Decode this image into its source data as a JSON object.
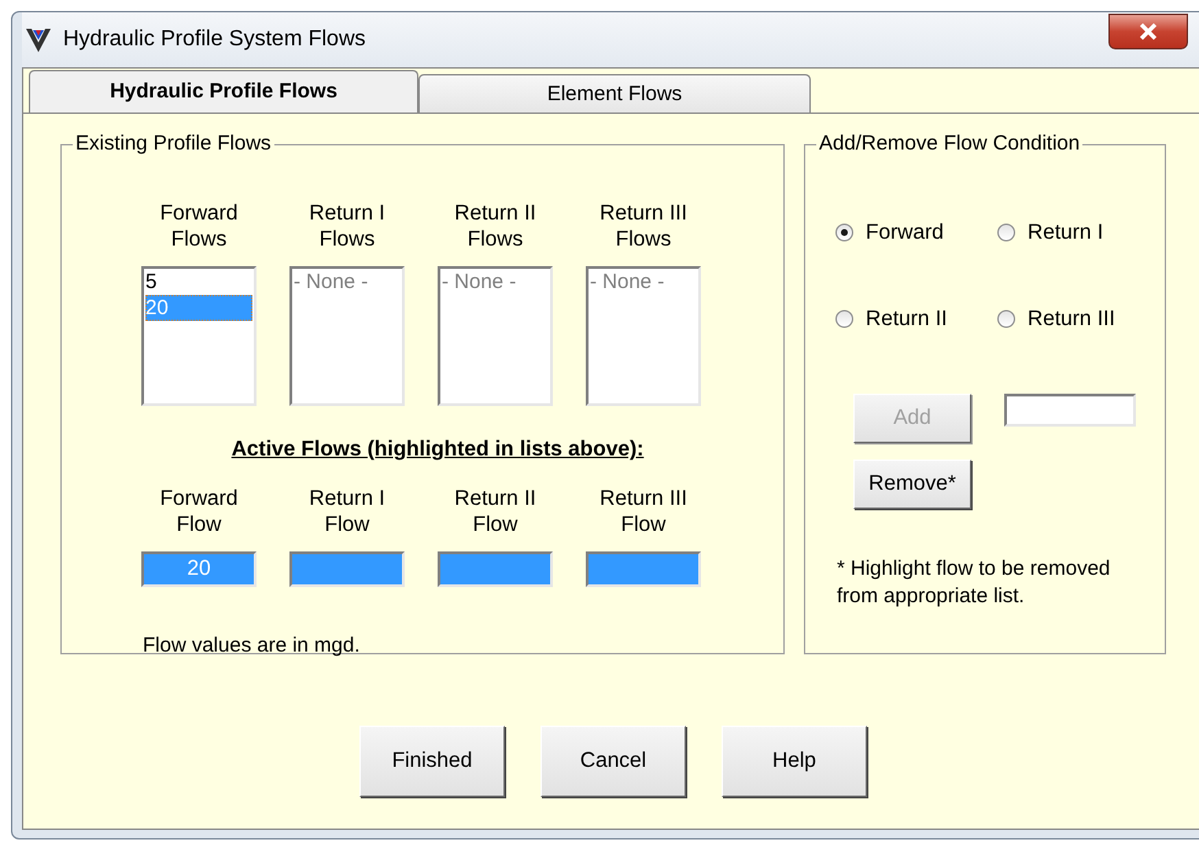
{
  "window": {
    "title": "Hydraulic Profile System Flows"
  },
  "tabs": [
    {
      "label": "Hydraulic Profile Flows",
      "selected": true
    },
    {
      "label": "Element Flows",
      "selected": false
    }
  ],
  "existing_flows": {
    "title": "Existing Profile Flows",
    "lists": [
      {
        "heading": "Forward Flows",
        "items": [
          {
            "text": "5",
            "selected": false,
            "disabled": false
          },
          {
            "text": "20",
            "selected": true,
            "disabled": false
          }
        ]
      },
      {
        "heading": "Return I Flows",
        "items": [
          {
            "text": "- None -",
            "selected": false,
            "disabled": true
          }
        ]
      },
      {
        "heading": "Return II Flows",
        "items": [
          {
            "text": "- None -",
            "selected": false,
            "disabled": true
          }
        ]
      },
      {
        "heading": "Return III Flows",
        "items": [
          {
            "text": "- None -",
            "selected": false,
            "disabled": true
          }
        ]
      }
    ],
    "active_title": "Active Flows (highlighted in lists above):",
    "active_fields": [
      {
        "label": "Forward Flow",
        "value": "20"
      },
      {
        "label": "Return I Flow"
      },
      {
        "label": "Return II Flow"
      },
      {
        "label": "Return III Flow"
      }
    ],
    "note": "Flow values are in mgd."
  },
  "flow_condition": {
    "title": "Add/Remove Flow Condition",
    "radios": [
      {
        "label": "Forward",
        "selected": true
      },
      {
        "label": "Return I",
        "selected": false
      },
      {
        "label": "Return II",
        "selected": false
      },
      {
        "label": "Return III",
        "selected": false
      }
    ],
    "buttons": [
      {
        "label": "Add",
        "disabled": true
      },
      {
        "label": "Remove*",
        "disabled": false
      }
    ],
    "note": "* Highlight flow to be removed from appropriate list."
  },
  "buttons": [
    "Finished",
    "Cancel",
    "Help"
  ]
}
